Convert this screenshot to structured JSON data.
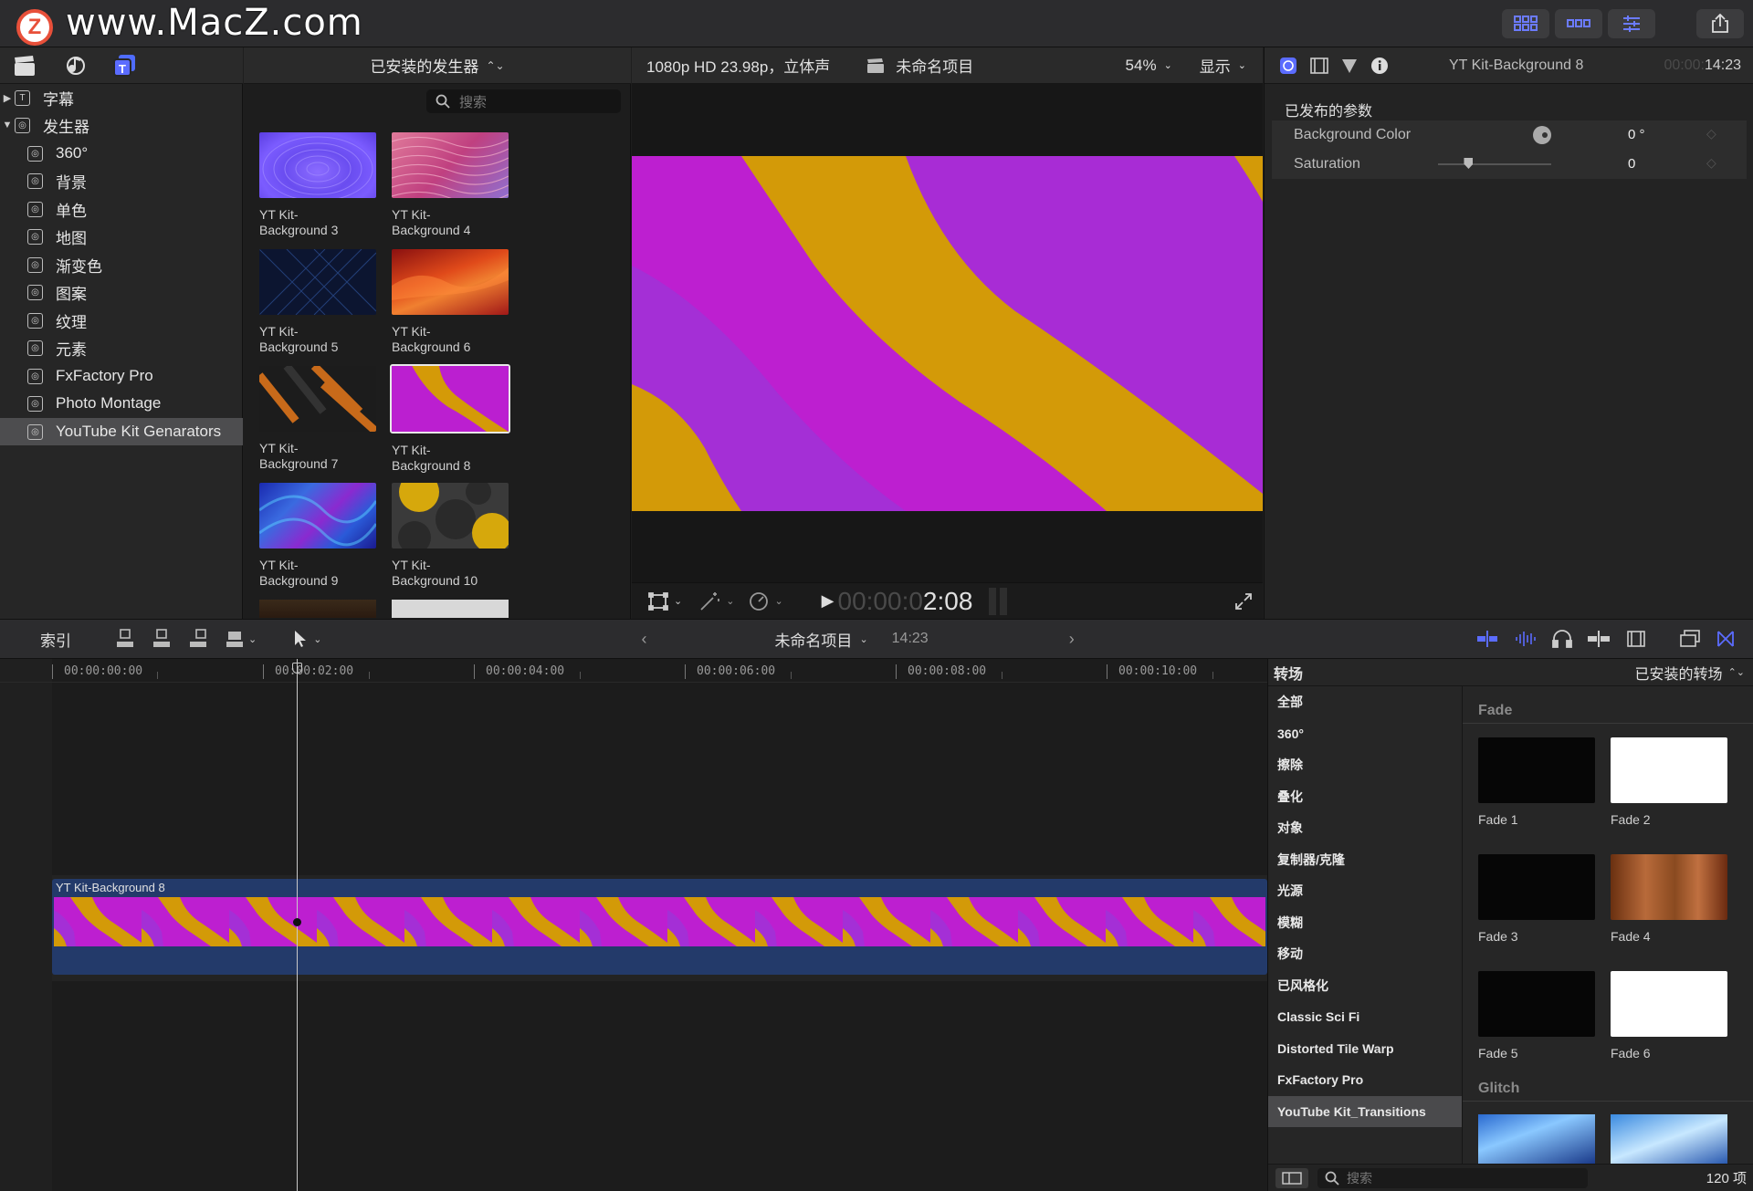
{
  "toolbar": {
    "watermark": "www.MacZ.com",
    "logo_letter": "Z",
    "buttons": [
      "grid-view-icon",
      "filmstrip-icon",
      "inspector-icon",
      "share-icon"
    ]
  },
  "sidebar": {
    "items": [
      {
        "label": "字幕",
        "expanded": false,
        "level": 0
      },
      {
        "label": "发生器",
        "expanded": true,
        "level": 0
      },
      {
        "label": "360°",
        "level": 1
      },
      {
        "label": "背景",
        "level": 1
      },
      {
        "label": "单色",
        "level": 1
      },
      {
        "label": "地图",
        "level": 1
      },
      {
        "label": "渐变色",
        "level": 1
      },
      {
        "label": "图案",
        "level": 1
      },
      {
        "label": "纹理",
        "level": 1
      },
      {
        "label": "元素",
        "level": 1
      },
      {
        "label": "FxFactory Pro",
        "level": 1
      },
      {
        "label": "Photo Montage",
        "level": 1
      },
      {
        "label": "YouTube Kit Genarators",
        "level": 1,
        "selected": true
      }
    ]
  },
  "browser": {
    "header": "已安装的发生器",
    "search_placeholder": "搜索",
    "items": [
      {
        "line1": "YT Kit-",
        "line2": "Background 3",
        "style": "purple-ripple"
      },
      {
        "line1": "YT Kit-",
        "line2": "Background 4",
        "style": "pink-waves"
      },
      {
        "line1": "YT Kit-",
        "line2": "Background 5",
        "style": "dark-lines"
      },
      {
        "line1": "YT Kit-",
        "line2": "Background 6",
        "style": "fire-waves"
      },
      {
        "line1": "YT Kit-",
        "line2": "Background 7",
        "style": "orange-stripes"
      },
      {
        "line1": "YT Kit-",
        "line2": "Background 8",
        "style": "magenta-gold",
        "selected": true
      },
      {
        "line1": "YT Kit-",
        "line2": "Background 9",
        "style": "blue-swirl"
      },
      {
        "line1": "YT Kit-",
        "line2": "Background 10",
        "style": "yellow-circles"
      }
    ]
  },
  "viewer": {
    "format": "1080p HD 23.98p，立体声",
    "project": "未命名项目",
    "zoom": "54%",
    "display": "显示",
    "timecode_dim": "00:00:0",
    "timecode_bright": "2:08"
  },
  "inspector": {
    "title": "YT Kit-Background 8",
    "duration_dim": "00:00:",
    "duration": "14:23",
    "section": "已发布的参数",
    "params": [
      {
        "label": "Background Color",
        "value": "0",
        "unit": "°"
      },
      {
        "label": "Saturation",
        "value": "0",
        "unit": ""
      }
    ],
    "saturation_level": 0.27
  },
  "timeline_bar": {
    "index": "索引",
    "project": "未命名项目",
    "duration": "14:23"
  },
  "timeline": {
    "ruler": [
      "00:00:00:00",
      "00:00:02:00",
      "00:00:04:00",
      "00:00:06:00",
      "00:00:08:00",
      "00:00:10:00"
    ],
    "clip_name": "YT Kit-Background 8",
    "playhead_time": "00:00:02:08"
  },
  "transitions": {
    "title": "转场",
    "installed": "已安装的转场",
    "categories": [
      "全部",
      "360°",
      "擦除",
      "叠化",
      "对象",
      "复制器/克隆",
      "光源",
      "模糊",
      "移动",
      "已风格化",
      "Classic Sci Fi",
      "Distorted Tile Warp",
      "FxFactory Pro",
      "YouTube Kit_Transitions"
    ],
    "selected_category": "YouTube Kit_Transitions",
    "group1": "Fade",
    "fades": [
      {
        "name": "Fade 1",
        "style": "black"
      },
      {
        "name": "Fade 2",
        "style": "white"
      },
      {
        "name": "Fade 3",
        "style": "black"
      },
      {
        "name": "Fade 4",
        "style": "amber"
      },
      {
        "name": "Fade 5",
        "style": "black"
      },
      {
        "name": "Fade 6",
        "style": "white"
      }
    ],
    "group2": "Glitch",
    "search_placeholder": "搜索",
    "count": "120 项"
  },
  "colors": {
    "magenta": "#bf1fd0",
    "purple": "#a12fd6",
    "gold": "#d49a08",
    "accent_blue": "#5b6cff"
  }
}
